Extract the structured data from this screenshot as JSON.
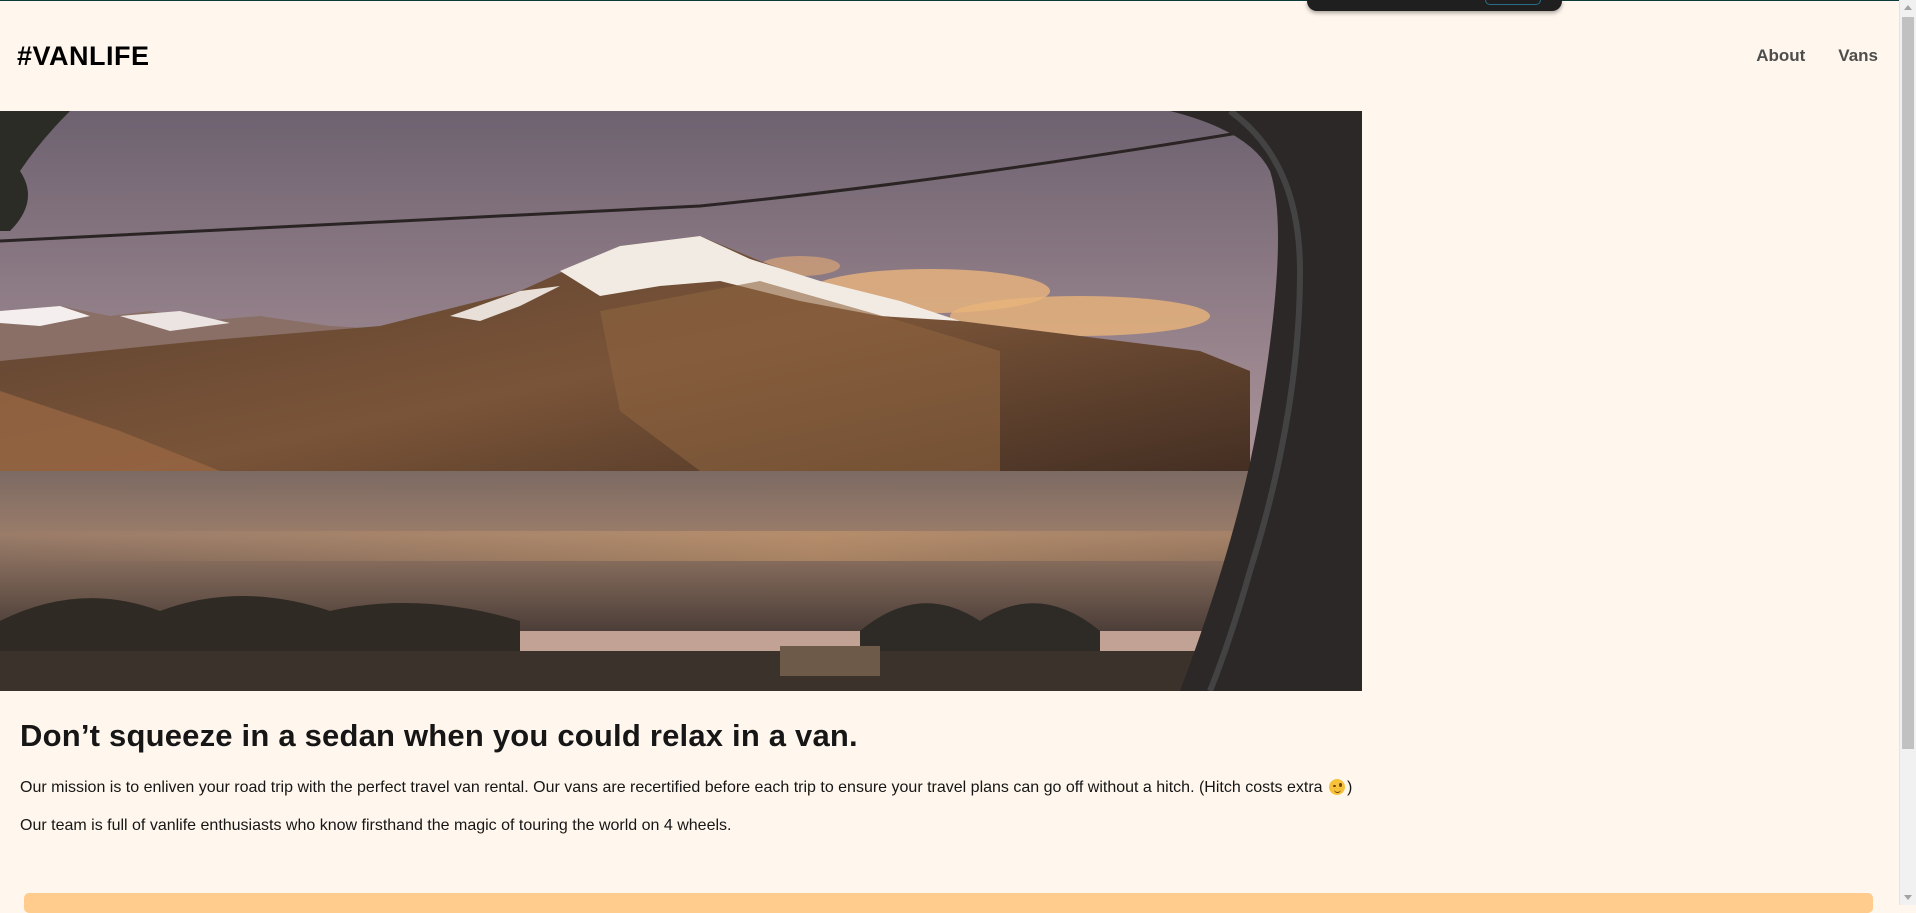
{
  "header": {
    "logo": "#VANLIFE",
    "nav": [
      {
        "label": "About"
      },
      {
        "label": "Vans"
      }
    ]
  },
  "hero": {
    "image_description_icon": "mountain-lake-photo"
  },
  "main": {
    "headline": "Don’t squeeze in a sedan when you could relax in a van.",
    "paragraph_1": "Our mission is to enliven your road trip with the perfect travel van rental. Our vans are recertified before each trip to ensure your travel plans can go off without a hitch. (Hitch costs extra",
    "paragraph_1_end": ")",
    "paragraph_2": "Our team is full of vanlife enthusiasts who know firsthand the magic of touring the world on 4 wheels."
  },
  "colors": {
    "page_background": "#FFF7ED",
    "cta_background": "#FFCC8D",
    "text_dark": "#161616",
    "nav_text": "#4D4D4D"
  }
}
